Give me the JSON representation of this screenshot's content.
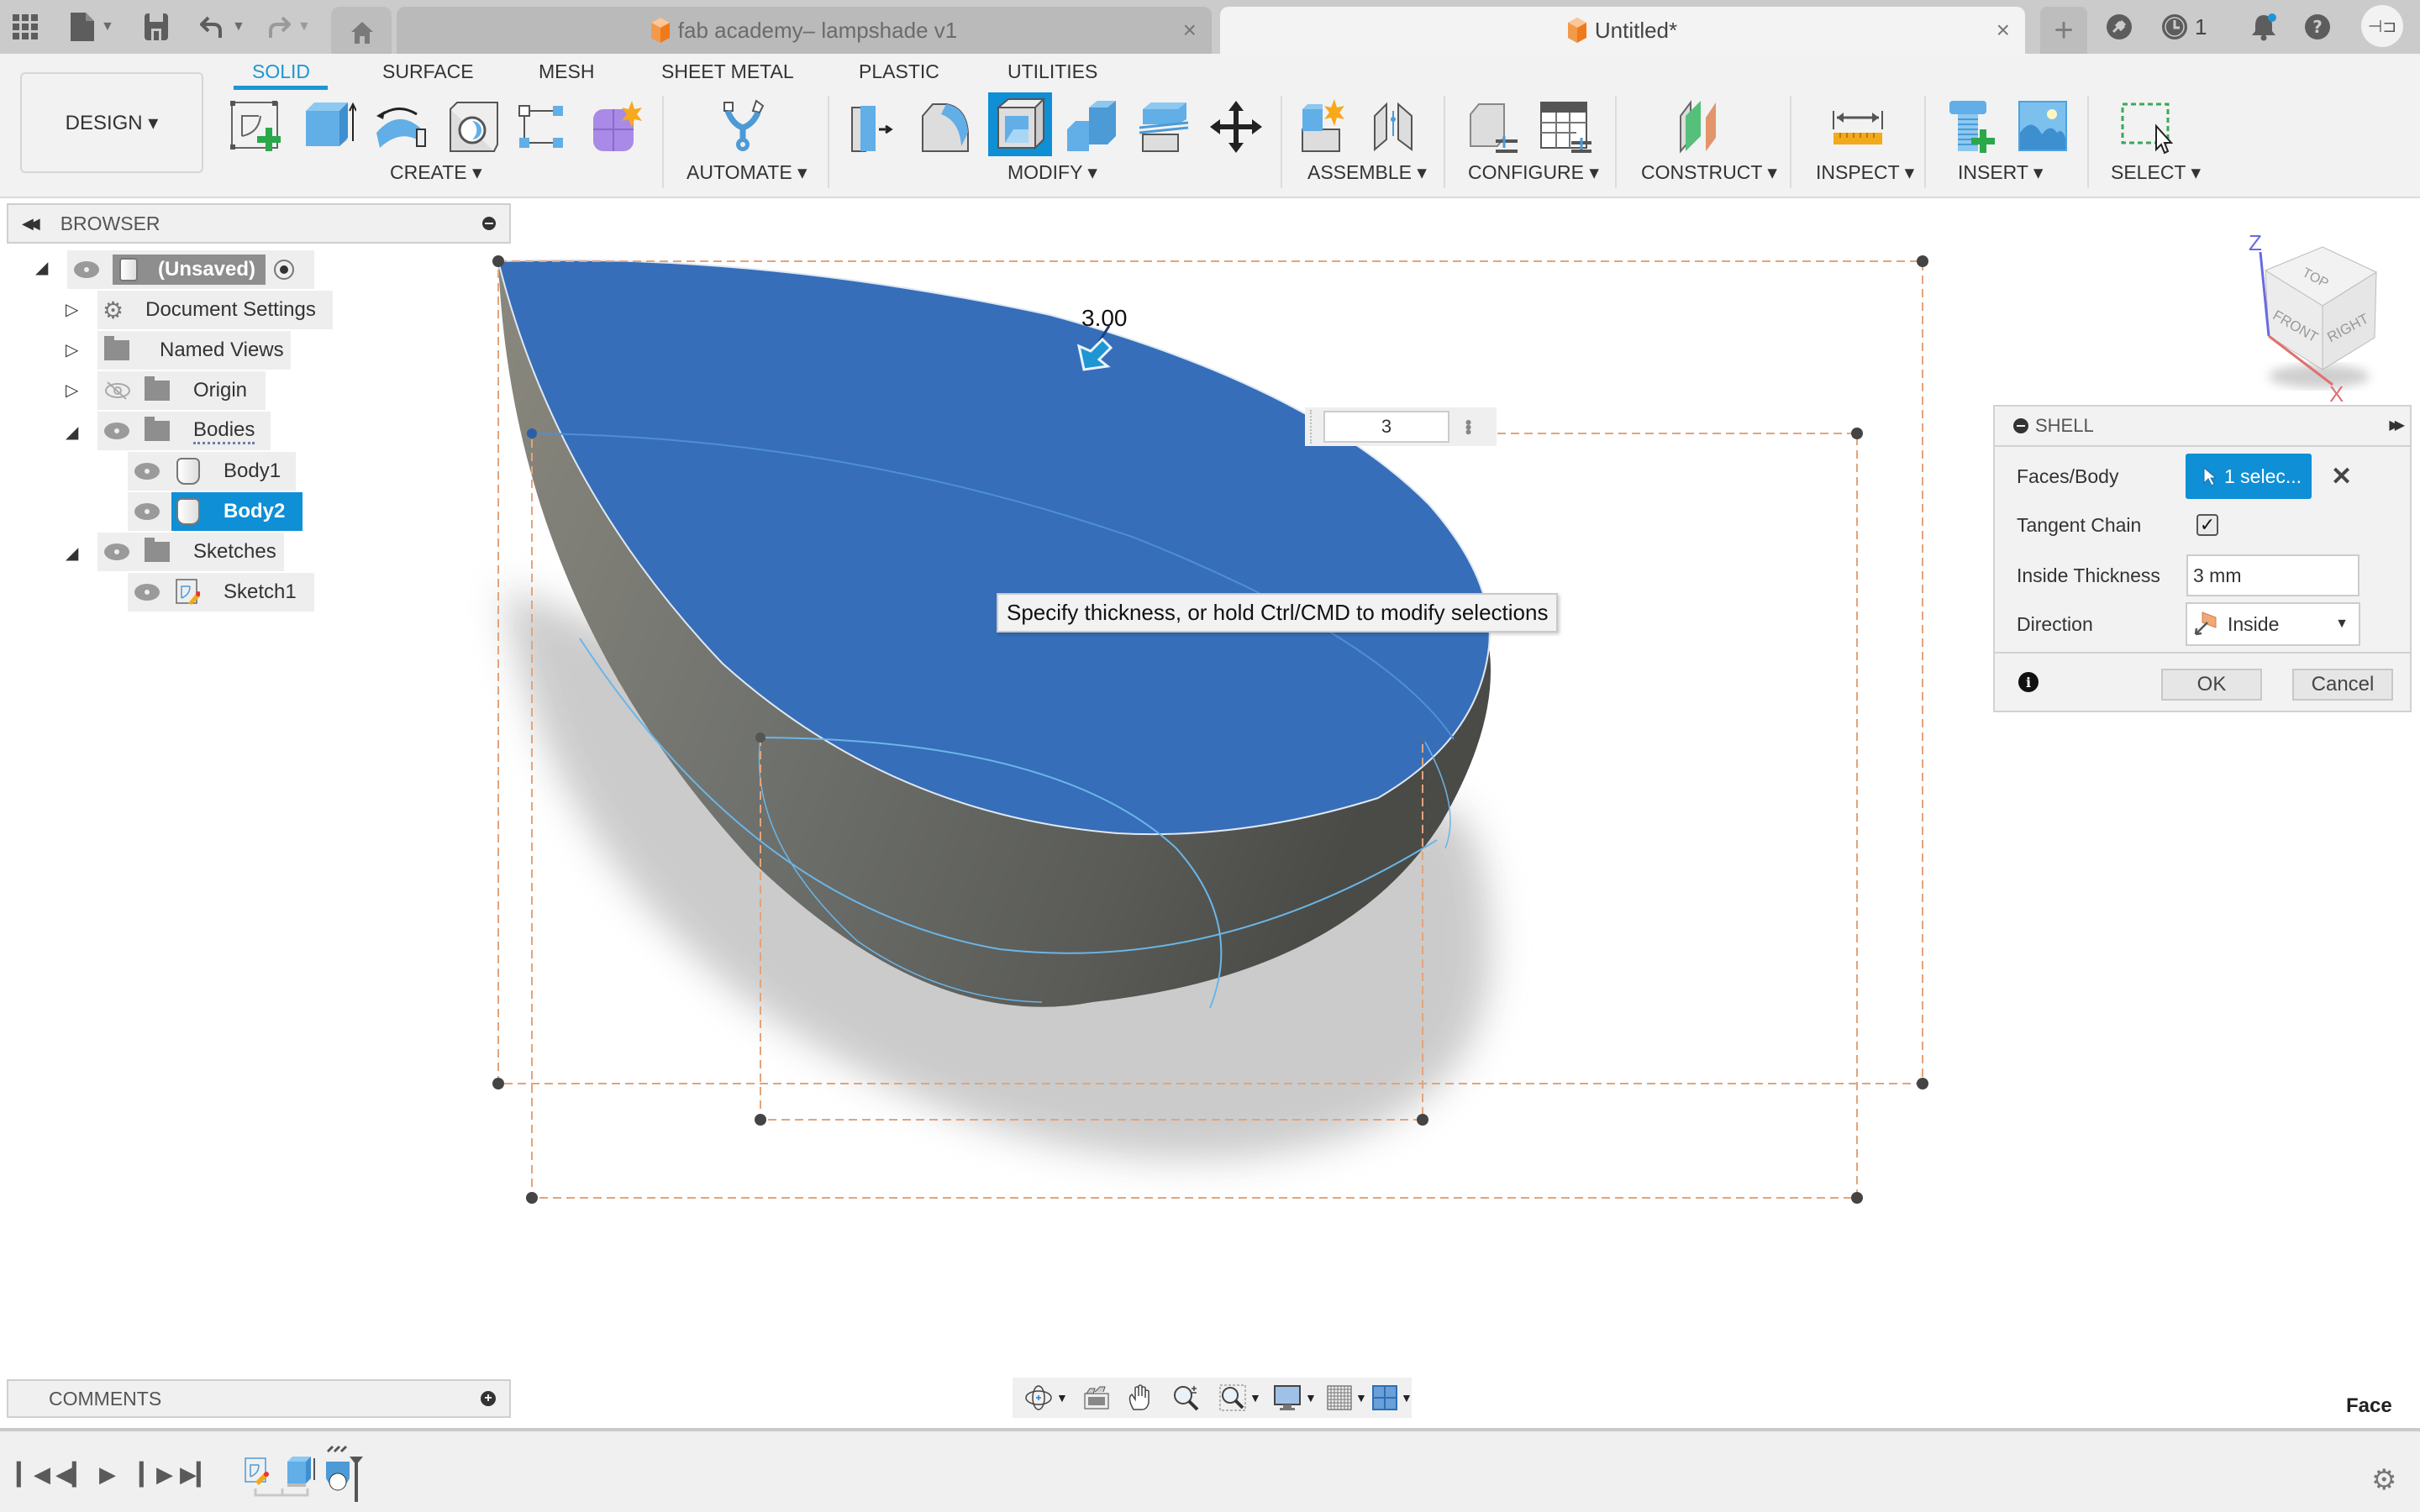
{
  "topbar": {
    "icons": [
      "apps-grid-icon",
      "file-icon",
      "save-icon",
      "undo-icon",
      "redo-icon",
      "home-icon"
    ],
    "tabs": [
      {
        "label": "fab academy– lampshade v1",
        "close": "×",
        "active": false
      },
      {
        "label": "Untitled*",
        "close": "×",
        "active": true
      }
    ],
    "new_tab": "+",
    "job_count": "1",
    "avatar_initials": "⊣⊐"
  },
  "ribbon": {
    "workspace": "DESIGN ▾",
    "tabs": [
      "SOLID",
      "SURFACE",
      "MESH",
      "SHEET METAL",
      "PLASTIC",
      "UTILITIES"
    ],
    "active_tab": "SOLID",
    "groups": [
      "CREATE ▾",
      "AUTOMATE ▾",
      "MODIFY ▾",
      "ASSEMBLE ▾",
      "CONFIGURE ▾",
      "CONSTRUCT ▾",
      "INSPECT ▾",
      "INSERT ▾",
      "SELECT ▾"
    ]
  },
  "browser": {
    "title": "BROWSER",
    "root": "(Unsaved)",
    "items": [
      {
        "label": "Document Settings"
      },
      {
        "label": "Named Views"
      },
      {
        "label": "Origin"
      },
      {
        "label": "Bodies"
      },
      {
        "label": "Body1"
      },
      {
        "label": "Body2",
        "selected": true
      },
      {
        "label": "Sketches"
      },
      {
        "label": "Sketch1"
      }
    ]
  },
  "viewport": {
    "dimension_label": "3.00",
    "value_input": "3",
    "tooltip": "Specify thickness, or hold Ctrl/CMD to modify selections",
    "viewcube": {
      "top": "TOP",
      "front": "FRONT",
      "right": "RIGHT",
      "axis_z": "Z",
      "axis_x": "X"
    },
    "selection_filter": "Face"
  },
  "shell": {
    "title": "SHELL",
    "faces_label": "Faces/Body",
    "faces_value": "1 selec...",
    "clear": "✕",
    "tangent_label": "Tangent Chain",
    "tangent_checked": true,
    "thickness_label": "Inside Thickness",
    "thickness_value": "3 mm",
    "direction_label": "Direction",
    "direction_value": "Inside",
    "ok": "OK",
    "cancel": "Cancel",
    "info": "i"
  },
  "comments": {
    "title": "COMMENTS"
  },
  "colors": {
    "accent": "#1e96d3",
    "selected_face": "#366eb9",
    "selection_button": "#0f8fd5"
  }
}
